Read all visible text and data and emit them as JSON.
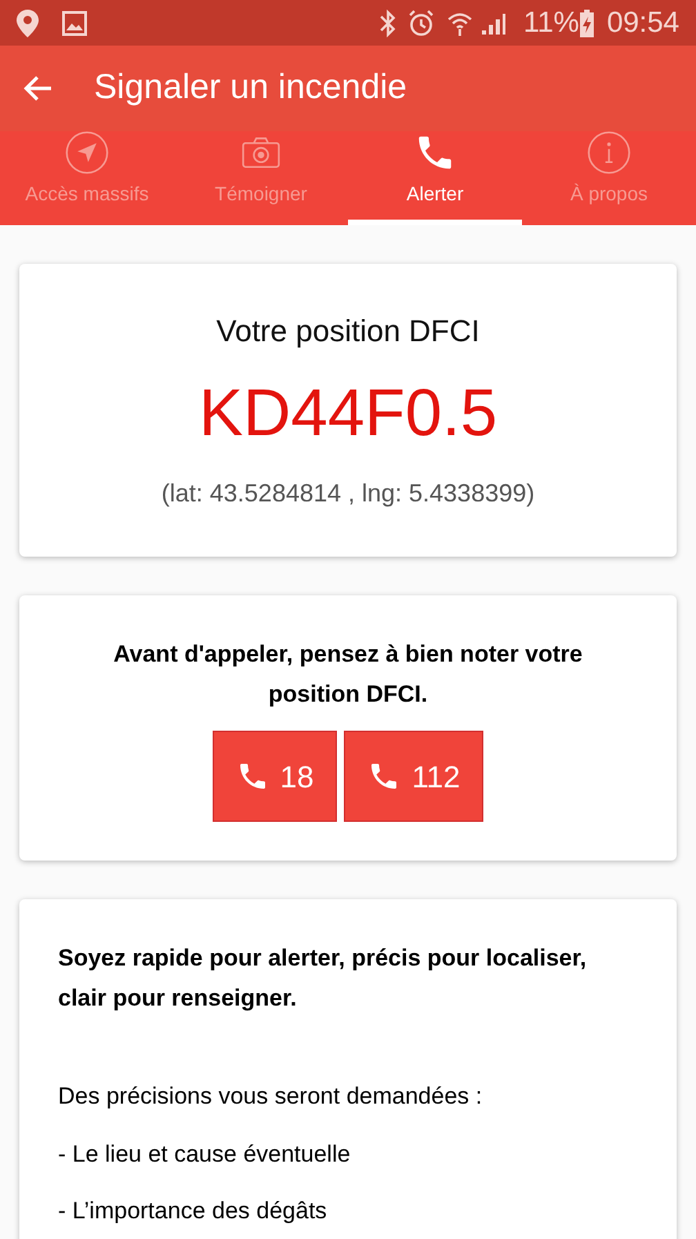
{
  "status_bar": {
    "battery": "11%",
    "time": "09:54"
  },
  "toolbar": {
    "title": "Signaler un incendie"
  },
  "tabs": [
    {
      "label": "Accès massifs",
      "kind": "navigate",
      "selected": false
    },
    {
      "label": "Témoigner",
      "kind": "camera",
      "selected": false
    },
    {
      "label": "Alerter",
      "kind": "phone",
      "selected": true
    },
    {
      "label": "À propos",
      "kind": "info",
      "selected": false
    }
  ],
  "position_card": {
    "title": "Votre position DFCI",
    "code": "KD44F0.5",
    "coordinates": "(lat: 43.5284814 , lng: 5.4338399)"
  },
  "call_card": {
    "notice": "Avant d'appeler, pensez à bien noter votre position DFCI.",
    "buttons": [
      "18",
      "112"
    ]
  },
  "info_card": {
    "heading": "Soyez rapide pour alerter, précis pour localiser, clair pour renseigner.",
    "intro": "Des précisions vous seront demandées :",
    "items": [
      "- Le lieu et cause éventuelle",
      "- L’importance des dégâts"
    ]
  }
}
